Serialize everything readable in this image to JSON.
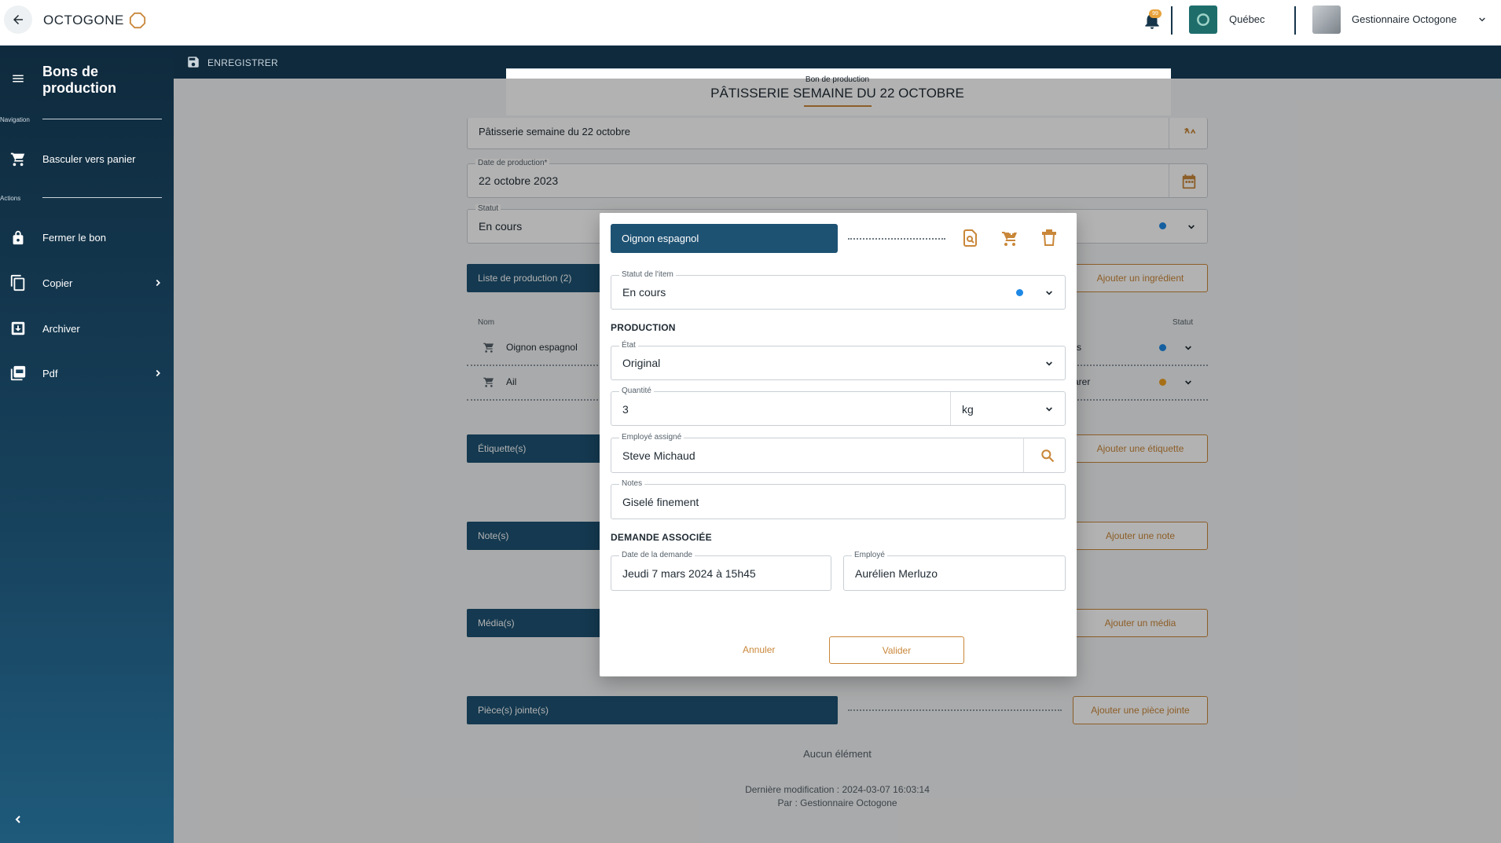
{
  "topbar": {
    "app_name": "OCTOGONE",
    "notification_count": "99",
    "region": "Québec",
    "user_name": "Gestionnaire Octogone"
  },
  "sidebar": {
    "title": "Bons de production",
    "section_navigation": "Navigation",
    "section_actions": "Actions",
    "items": [
      {
        "label": "Basculer vers panier",
        "icon": "cart-swap-icon"
      },
      {
        "label": "Fermer le bon",
        "icon": "lock-icon"
      },
      {
        "label": "Copier",
        "icon": "copy-icon"
      },
      {
        "label": "Archiver",
        "icon": "archive-icon"
      },
      {
        "label": "Pdf",
        "icon": "pdf-icon"
      }
    ]
  },
  "actionbar": {
    "save_label": "ENREGISTRER"
  },
  "document": {
    "kicker": "Bon de production",
    "title": "PÂTISSERIE SEMAINE DU 22 OCTOBRE",
    "name_value": "Pâtisserie semaine du 22 octobre",
    "production_date_label": "Date de production*",
    "production_date_value": "22 octobre 2023",
    "status_label": "Statut",
    "status_value": "En cours",
    "production_list_label": "Liste de production (2)",
    "add_ingredient_label": "Ajouter un ingrédient",
    "col_name": "Nom",
    "col_status": "Statut",
    "rows": [
      {
        "name": "Oignon espagnol",
        "status_partial": "rs"
      },
      {
        "name": "Ail",
        "status_partial": "arer"
      }
    ],
    "labels_section": "Étiquette(s)",
    "add_label": "Ajouter une étiquette",
    "notes_section": "Note(s)",
    "add_note": "Ajouter une note",
    "media_section": "Média(s)",
    "add_media": "Ajouter un média",
    "attachments_section": "Pièce(s) jointe(s)",
    "add_attachment": "Ajouter une pièce jointe",
    "empty_text": "Aucun élément",
    "last_modified": "Dernière modification : 2024-03-07 16:03:14",
    "modified_by": "Par : Gestionnaire Octogone"
  },
  "modal": {
    "item_name": "Oignon espagnol",
    "item_status_label": "Statut de l'item",
    "item_status_value": "En cours",
    "production_heading": "PRODUCTION",
    "state_label": "État",
    "state_value": "Original",
    "quantity_label": "Quantité",
    "quantity_value": "3",
    "unit_value": "kg",
    "employee_label": "Employé assigné",
    "employee_value": "Steve Michaud",
    "notes_label": "Notes",
    "notes_value": "Giselé finement",
    "request_heading": "DEMANDE ASSOCIÉE",
    "request_date_label": "Date de la demande",
    "request_date_value": "Jeudi 7 mars 2024 à 15h45",
    "request_employee_label": "Employé",
    "request_employee_value": "Aurélien Merluzo",
    "cancel_label": "Annuler",
    "validate_label": "Valider"
  },
  "colors": {
    "navy": "#0f2a3d",
    "primary": "#1e5273",
    "accent": "#c9873a",
    "status_blue": "#1e88e5",
    "status_orange": "#f0a020"
  }
}
